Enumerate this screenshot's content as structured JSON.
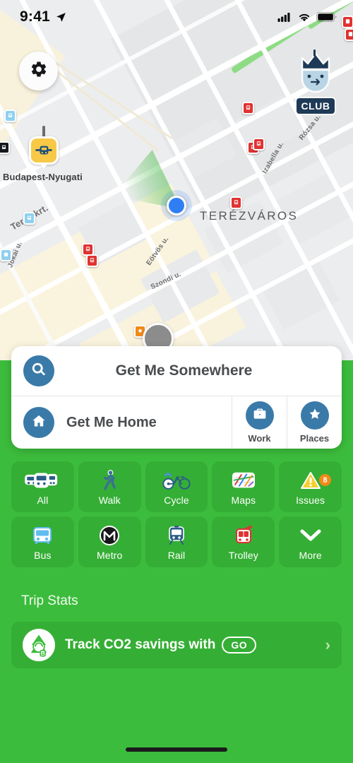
{
  "status_bar": {
    "time": "9:41",
    "location_arrow": "location-arrow-icon",
    "signal": "cellular-signal-icon",
    "wifi": "wifi-icon",
    "battery": "battery-full-icon"
  },
  "map": {
    "settings_button": "gear-icon",
    "avatar_button": "profile-avatar",
    "club_marker_label": "CLUB",
    "district_label": "TERÉZVÁROS",
    "station_label": "Budapest-Nyugati",
    "street_labels": [
      "Teréz krt.",
      "Jókai u.",
      "Eötvös u.",
      "Szondi u.",
      "Izabella u.",
      "Rózsa u."
    ],
    "colors": {
      "location_dot": "#2f7ef4",
      "heading_cone": "#4cbb4c",
      "tram_marker": "#e03232",
      "rail_station": "#f7c947"
    }
  },
  "search_card": {
    "search_icon": "search-icon",
    "title": "Get Me Somewhere",
    "home_icon": "home-icon",
    "home_label": "Get Me Home",
    "work_icon": "briefcase-icon",
    "work_label": "Work",
    "places_icon": "star-icon",
    "places_label": "Places"
  },
  "modes": [
    {
      "label": "All",
      "icon": "multi-transit-icon"
    },
    {
      "label": "Walk",
      "icon": "walking-person-icon"
    },
    {
      "label": "Cycle",
      "icon": "bicycle-icon"
    },
    {
      "label": "Maps",
      "icon": "folded-map-icon"
    },
    {
      "label": "Issues",
      "icon": "warning-triangle-icon",
      "badge": "8"
    },
    {
      "label": "Bus",
      "icon": "bus-icon"
    },
    {
      "label": "Metro",
      "icon": "metro-m-icon"
    },
    {
      "label": "Rail",
      "icon": "train-icon"
    },
    {
      "label": "Trolley",
      "icon": "trolleybus-icon"
    },
    {
      "label": "More",
      "icon": "chevron-down-icon"
    }
  ],
  "trip_stats": {
    "section_title": "Trip Stats",
    "eco_icon": "eco-tree-icon",
    "text": "Track CO2 savings with",
    "go_label": "GO",
    "chevron": "chevron-right-icon"
  },
  "theme": {
    "background_green": "#3CBC3C",
    "tile_green": "#35ae35",
    "accent_blue": "#3a7aa8",
    "badge_orange": "#f08a18"
  }
}
